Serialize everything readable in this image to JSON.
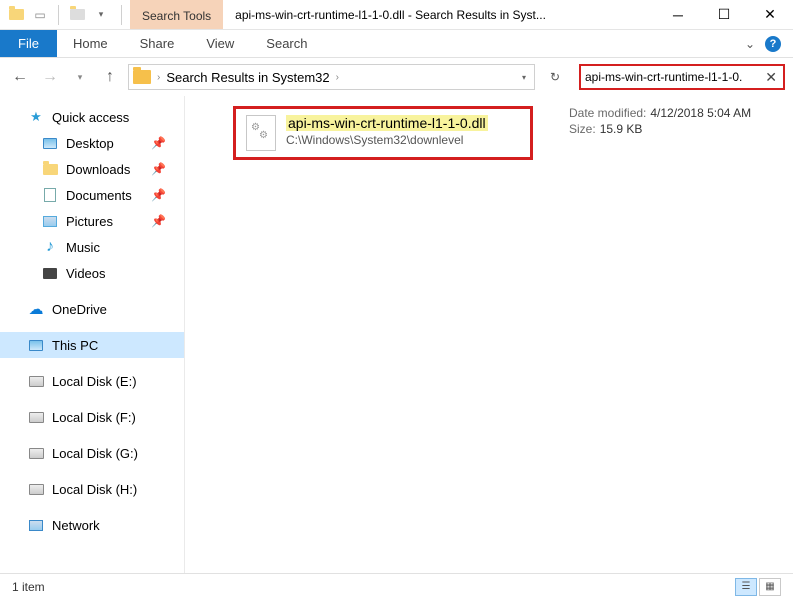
{
  "titlebar": {
    "search_tools": "Search Tools",
    "title": "api-ms-win-crt-runtime-l1-1-0.dll - Search Results in Syst..."
  },
  "ribbon": {
    "file": "File",
    "home": "Home",
    "share": "Share",
    "view": "View",
    "search": "Search"
  },
  "addressbar": {
    "crumb": "Search Results in System32",
    "search_text": "api-ms-win-crt-runtime-l1-1-0."
  },
  "sidebar": {
    "quick_access": "Quick access",
    "desktop": "Desktop",
    "downloads": "Downloads",
    "documents": "Documents",
    "pictures": "Pictures",
    "music": "Music",
    "videos": "Videos",
    "onedrive": "OneDrive",
    "this_pc": "This PC",
    "local_e": "Local Disk (E:)",
    "local_f": "Local Disk (F:)",
    "local_g": "Local Disk (G:)",
    "local_h": "Local Disk (H:)",
    "network": "Network"
  },
  "result": {
    "filename": "api-ms-win-crt-runtime-l1-1-0.dll",
    "filepath": "C:\\Windows\\System32\\downlevel"
  },
  "details": {
    "date_label": "Date modified:",
    "date_value": "4/12/2018 5:04 AM",
    "size_label": "Size:",
    "size_value": "15.9 KB"
  },
  "statusbar": {
    "count": "1 item"
  }
}
